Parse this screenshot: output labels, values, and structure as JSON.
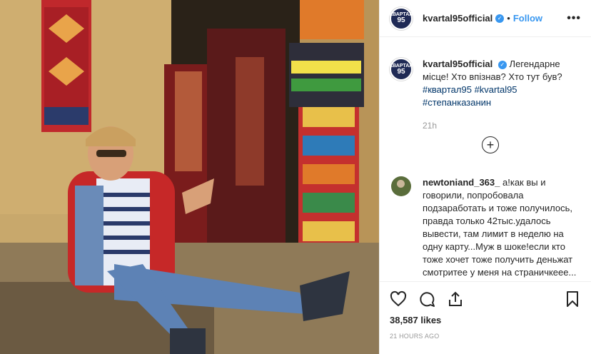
{
  "header": {
    "avatar_line1": "КВАРТАЛ",
    "avatar_line2": "95",
    "username": "kvartal95official",
    "verified_icon": "verified-badge-icon",
    "separator": "•",
    "follow_label": "Follow",
    "more_icon": "more-options-icon"
  },
  "caption": {
    "username": "kvartal95official",
    "text": "Легендарне місце! Хто впізнав? Хто тут був?",
    "tags": [
      "#квартал95",
      "#kvartal95",
      "#степанказанин"
    ],
    "time": "21h"
  },
  "load_more_icon": "plus-circle-icon",
  "comment": {
    "username": "newtoniand_363_",
    "text": "а!как вы и говорили, попробовала подзаработать и тоже получилось, правда только 42тыс.удалось вывести, там лимит в неделю на одну карту...Муж в шоке!если кто тоже хочет тоже получить деньжат смотритее у меня на страничкееe..."
  },
  "actions": {
    "like_icon": "heart-icon",
    "comment_icon": "comment-icon",
    "share_icon": "share-icon",
    "save_icon": "bookmark-icon"
  },
  "likes": "38,587 likes",
  "posted": "21 HOURS AGO",
  "colors": {
    "accent": "#3897f0",
    "tag": "#003569",
    "muted": "#999999"
  }
}
